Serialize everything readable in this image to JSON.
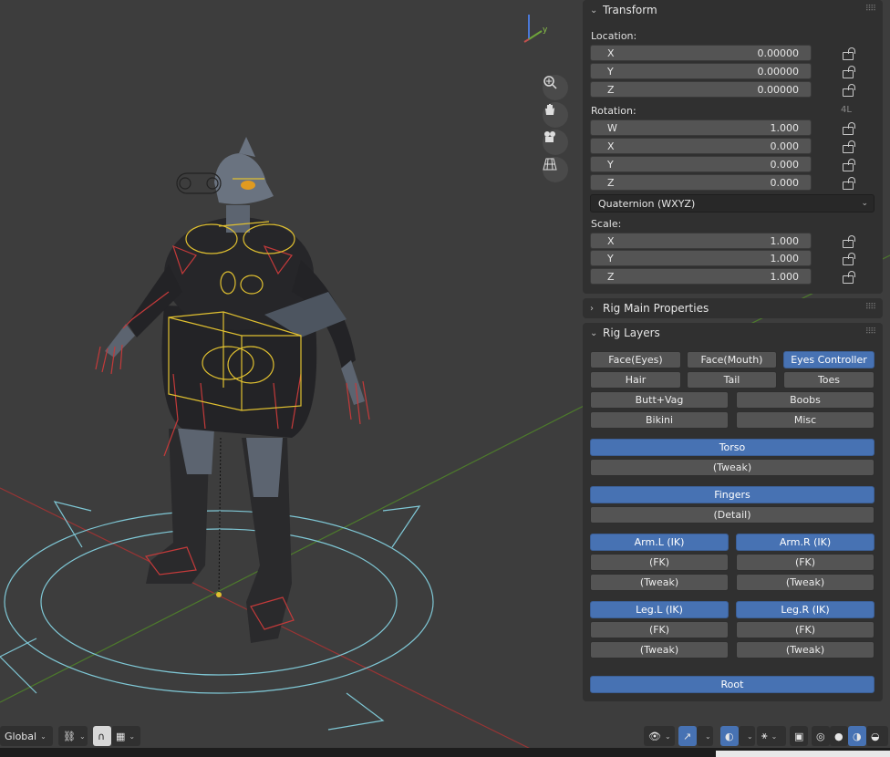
{
  "header": {
    "orientation": "Global"
  },
  "transform": {
    "title": "Transform",
    "location_label": "Location:",
    "location": [
      {
        "axis": "X",
        "value": "0.00000"
      },
      {
        "axis": "Y",
        "value": "0.00000"
      },
      {
        "axis": "Z",
        "value": "0.00000"
      }
    ],
    "rotation_label": "Rotation:",
    "rotation_lock_label": "4L",
    "rotation": [
      {
        "axis": "W",
        "value": "1.000"
      },
      {
        "axis": "X",
        "value": "0.000"
      },
      {
        "axis": "Y",
        "value": "0.000"
      },
      {
        "axis": "Z",
        "value": "0.000"
      }
    ],
    "rotation_mode": "Quaternion (WXYZ)",
    "scale_label": "Scale:",
    "scale": [
      {
        "axis": "X",
        "value": "1.000"
      },
      {
        "axis": "Y",
        "value": "1.000"
      },
      {
        "axis": "Z",
        "value": "1.000"
      }
    ]
  },
  "rig_main": {
    "title": "Rig Main Properties"
  },
  "rig_layers": {
    "title": "Rig Layers",
    "face_eyes": "Face(Eyes)",
    "face_mouth": "Face(Mouth)",
    "eyes_controller": "Eyes Controller",
    "hair": "Hair",
    "tail": "Tail",
    "toes": "Toes",
    "butt_vag": "Butt+Vag",
    "boobs": "Boobs",
    "bikini": "Bikini",
    "misc": "Misc",
    "torso": "Torso",
    "torso_tweak": "(Tweak)",
    "fingers": "Fingers",
    "fingers_detail": "(Detail)",
    "arm_l_ik": "Arm.L (IK)",
    "arm_r_ik": "Arm.R (IK)",
    "arm_l_fk": "(FK)",
    "arm_r_fk": "(FK)",
    "arm_l_tweak": "(Tweak)",
    "arm_r_tweak": "(Tweak)",
    "leg_l_ik": "Leg.L (IK)",
    "leg_r_ik": "Leg.R (IK)",
    "leg_l_fk": "(FK)",
    "leg_r_fk": "(FK)",
    "leg_l_tweak": "(Tweak)",
    "leg_r_tweak": "(Tweak)",
    "root": "Root"
  },
  "gizmo": {
    "y_label": "y"
  },
  "colors": {
    "accent": "#4772b3",
    "panel_bg": "#303030",
    "viewport_bg": "#3d3d3d",
    "x_axis": "#a03030",
    "y_axis": "#4f7a2a",
    "bone_red": "#c43a3a",
    "bone_yellow": "#e0c030"
  }
}
